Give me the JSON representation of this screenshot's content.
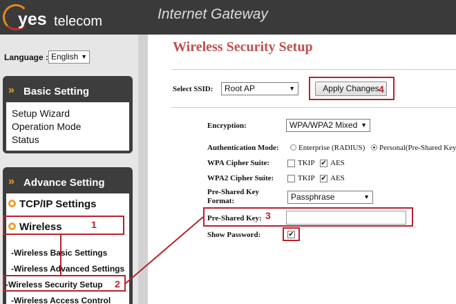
{
  "header": {
    "logo_yes": "yes",
    "logo_telecom": "telecom",
    "title": "Internet Gateway"
  },
  "language": {
    "label": "Language :",
    "value": "English"
  },
  "basic_setting": {
    "title": "Basic Setting",
    "items": [
      "Setup Wizard",
      "Operation Mode",
      "Status"
    ]
  },
  "advance_setting": {
    "title": "Advance Setting",
    "tcpip": "TCP/IP Settings",
    "wireless": "Wireless",
    "sub_items": [
      "-Wireless Basic Settings",
      "-Wireless Advanced Settings",
      "-Wireless Security Setup",
      "-Wireless Access Control"
    ]
  },
  "annotations": {
    "step1": "1",
    "step2": "2",
    "step3": "3",
    "step4": "4"
  },
  "main": {
    "title": "Wireless Security Setup",
    "ssid_label": "Select SSID:",
    "ssid_value": "Root AP",
    "apply_label": "Apply Changes",
    "encryption_label": "Encryption:",
    "encryption_value": "WPA/WPA2 Mixed",
    "auth_label": "Authentication Mode:",
    "auth_option_1": "Enterprise (RADIUS)",
    "auth_option_2": "Personal(Pre-Shared Key)",
    "wpa_cipher_label": "WPA Cipher Suite:",
    "wpa2_cipher_label": "WPA2 Cipher Suite:",
    "tkip": "TKIP",
    "aes": "AES",
    "psk_format_label_1": "Pre-Shared Key",
    "psk_format_label_2": "Format:",
    "psk_format_value": "Passphrase",
    "psk_label": "Pre-Shared Key:",
    "psk_value": "",
    "show_password_label": "Show Password:",
    "check_mark": "✔"
  },
  "colors": {
    "accent_red": "#b8202e",
    "title_red": "#c0504d",
    "orange": "#f0a030",
    "dark": "#3d3d3d"
  }
}
